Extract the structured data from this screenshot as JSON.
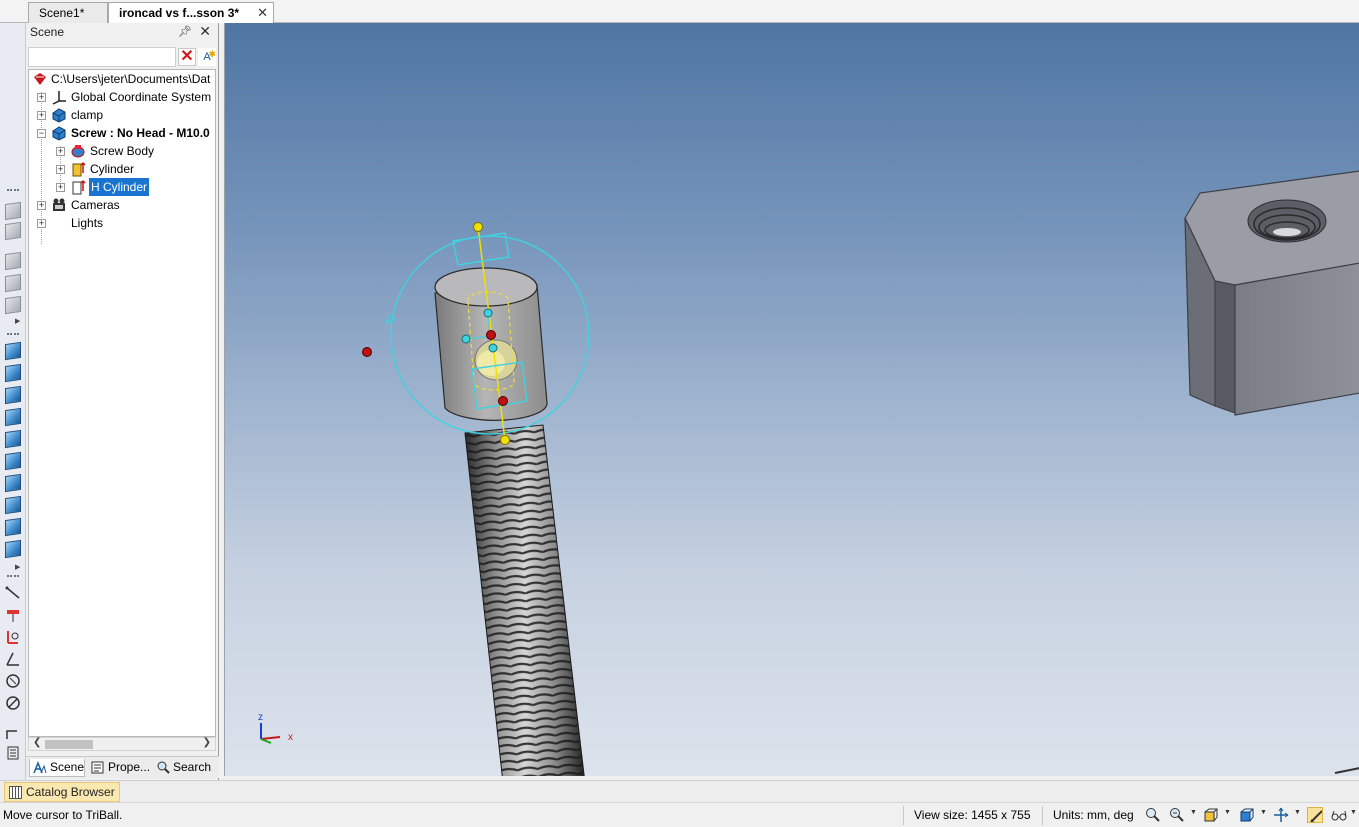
{
  "tabs": [
    {
      "label": "Scene1*"
    },
    {
      "label": "ironcad vs f...sson 3*",
      "active": true
    }
  ],
  "scene_panel": {
    "title": "Scene",
    "search_placeholder": "",
    "tree": [
      {
        "label": "C:\\Users\\jeter\\Documents\\Dat",
        "icon": "scene-root-icon"
      },
      {
        "label": "Global Coordinate System",
        "icon": "axes-icon"
      },
      {
        "label": "clamp",
        "icon": "part-icon"
      },
      {
        "label": "Screw : No Head - M10.0",
        "icon": "part-icon",
        "bold": true,
        "expanded": true
      },
      {
        "label": "Screw Body",
        "icon": "screw-body-icon"
      },
      {
        "label": "Cylinder",
        "icon": "cylinder-icon"
      },
      {
        "label": "H Cylinder",
        "icon": "hole-cylinder-icon",
        "selected": true
      },
      {
        "label": "Cameras",
        "icon": "camera-icon"
      },
      {
        "label": "Lights",
        "icon": "light-icon"
      }
    ],
    "bottom_tabs": [
      {
        "label": "Scene",
        "active": true
      },
      {
        "label": "Prope..."
      },
      {
        "label": "Search"
      }
    ]
  },
  "viewport": {
    "axis_z": "z",
    "axis_x": "x"
  },
  "catalog_browser": {
    "label": "Catalog Browser"
  },
  "status": {
    "message": "Move cursor to TriBall.",
    "view_size": "View size: 1455 x  755",
    "units": "Units: mm, deg"
  },
  "colors": {
    "selection": "#1874d0",
    "triball": "#3fd2e0",
    "handle_yellow": "#f1e000",
    "handle_red": "#c01010"
  }
}
